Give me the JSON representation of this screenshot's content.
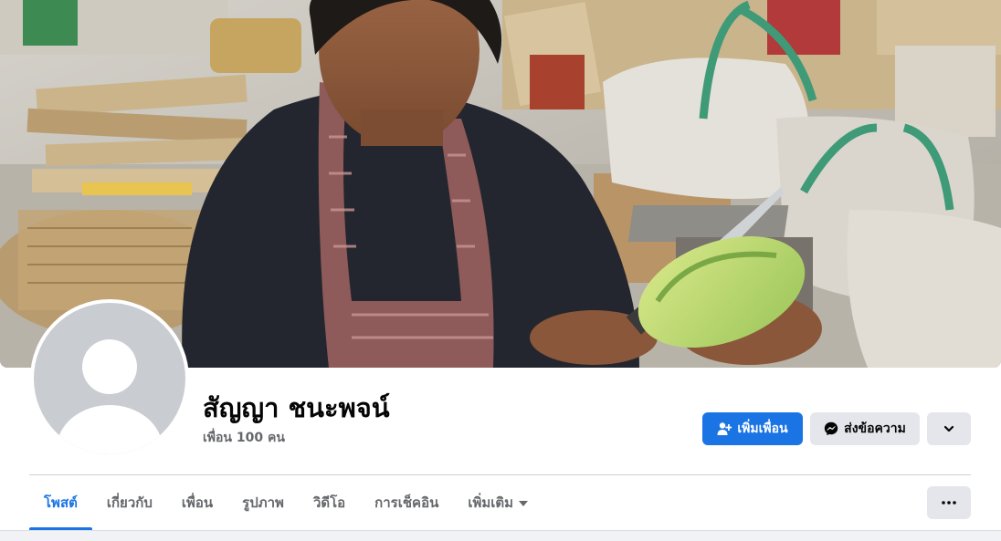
{
  "profile": {
    "name": "สัญญา ชนะพจน์",
    "friends": "เพื่อน 100 คน"
  },
  "actions": {
    "add_friend": "เพิ่มเพื่อน",
    "message": "ส่งข้อความ"
  },
  "tabs": [
    {
      "label": "โพสต์",
      "active": true
    },
    {
      "label": "เกี่ยวกับ",
      "active": false
    },
    {
      "label": "เพื่อน",
      "active": false
    },
    {
      "label": "รูปภาพ",
      "active": false
    },
    {
      "label": "วิดีโอ",
      "active": false
    },
    {
      "label": "การเช็คอิน",
      "active": false
    },
    {
      "label": "เพิ่มเติม",
      "active": false
    }
  ],
  "icons": {
    "add_friend": "person-plus-icon",
    "message": "messenger-icon",
    "more_actions": "chevron-down-icon",
    "tabs_more": "ellipsis-icon",
    "tab_more_caret": "caret-down-icon"
  },
  "colors": {
    "accent": "#1b74e4",
    "secondary_button": "#e4e6eb",
    "muted_text": "#65676b",
    "avatar_placeholder": "#c9ccd1"
  }
}
